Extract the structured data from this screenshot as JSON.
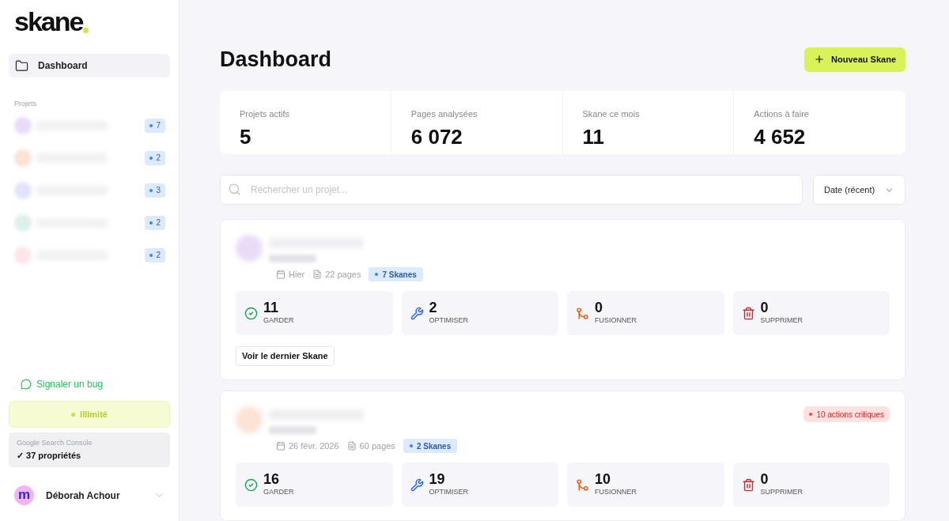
{
  "sidebar": {
    "logo": "skane",
    "nav": [
      {
        "label": "Dashboard",
        "selected": true
      }
    ],
    "projects_heading": "Projets",
    "projects": [
      {
        "color": "#e9dcf7",
        "count": "7"
      },
      {
        "color": "#fbe3d6",
        "count": "2"
      },
      {
        "color": "#e3e4fb",
        "count": "3"
      },
      {
        "color": "#ddf0ec",
        "count": "2"
      },
      {
        "color": "#fbe6ea",
        "count": "2"
      }
    ],
    "bug_link": "Signaler un bug",
    "plan": "Illimité",
    "gsc": {
      "label": "Google Search Console",
      "value": "✓ 37 propriétés"
    },
    "user": {
      "avatar_letter": "m",
      "name": "Déborah Achour"
    }
  },
  "main": {
    "title": "Dashboard",
    "new_button": "Nouveau Skane",
    "stats": [
      {
        "label": "Projets actifs",
        "value": "5"
      },
      {
        "label": "Pages analysées",
        "value": "6 072"
      },
      {
        "label": "Skane ce mois",
        "value": "11"
      },
      {
        "label": "Actions à faire",
        "value": "4 652"
      }
    ],
    "search": {
      "placeholder": "Rechercher un projet..."
    },
    "sort": "Date (récent)",
    "projects": [
      {
        "color": "#e9dcf7",
        "date": "Hier",
        "pages": "22 pages",
        "skanes": "7 Skanes",
        "actions": [
          {
            "kind": "keep",
            "value": "11",
            "label": "GARDER"
          },
          {
            "kind": "optimize",
            "value": "2",
            "label": "OPTIMISER"
          },
          {
            "kind": "merge",
            "value": "0",
            "label": "FUSIONNER"
          },
          {
            "kind": "delete",
            "value": "0",
            "label": "SUPPRIMER"
          }
        ],
        "button": "Voir le dernier Skane"
      },
      {
        "color": "#fbe3d6",
        "date": "26 févr. 2026",
        "pages": "60 pages",
        "skanes": "2 Skanes",
        "alert": "10 actions critiques",
        "actions": [
          {
            "kind": "keep",
            "value": "16",
            "label": "GARDER"
          },
          {
            "kind": "optimize",
            "value": "19",
            "label": "OPTIMISER"
          },
          {
            "kind": "merge",
            "value": "10",
            "label": "FUSIONNER"
          },
          {
            "kind": "delete",
            "value": "0",
            "label": "SUPPRIMER"
          }
        ]
      }
    ]
  }
}
